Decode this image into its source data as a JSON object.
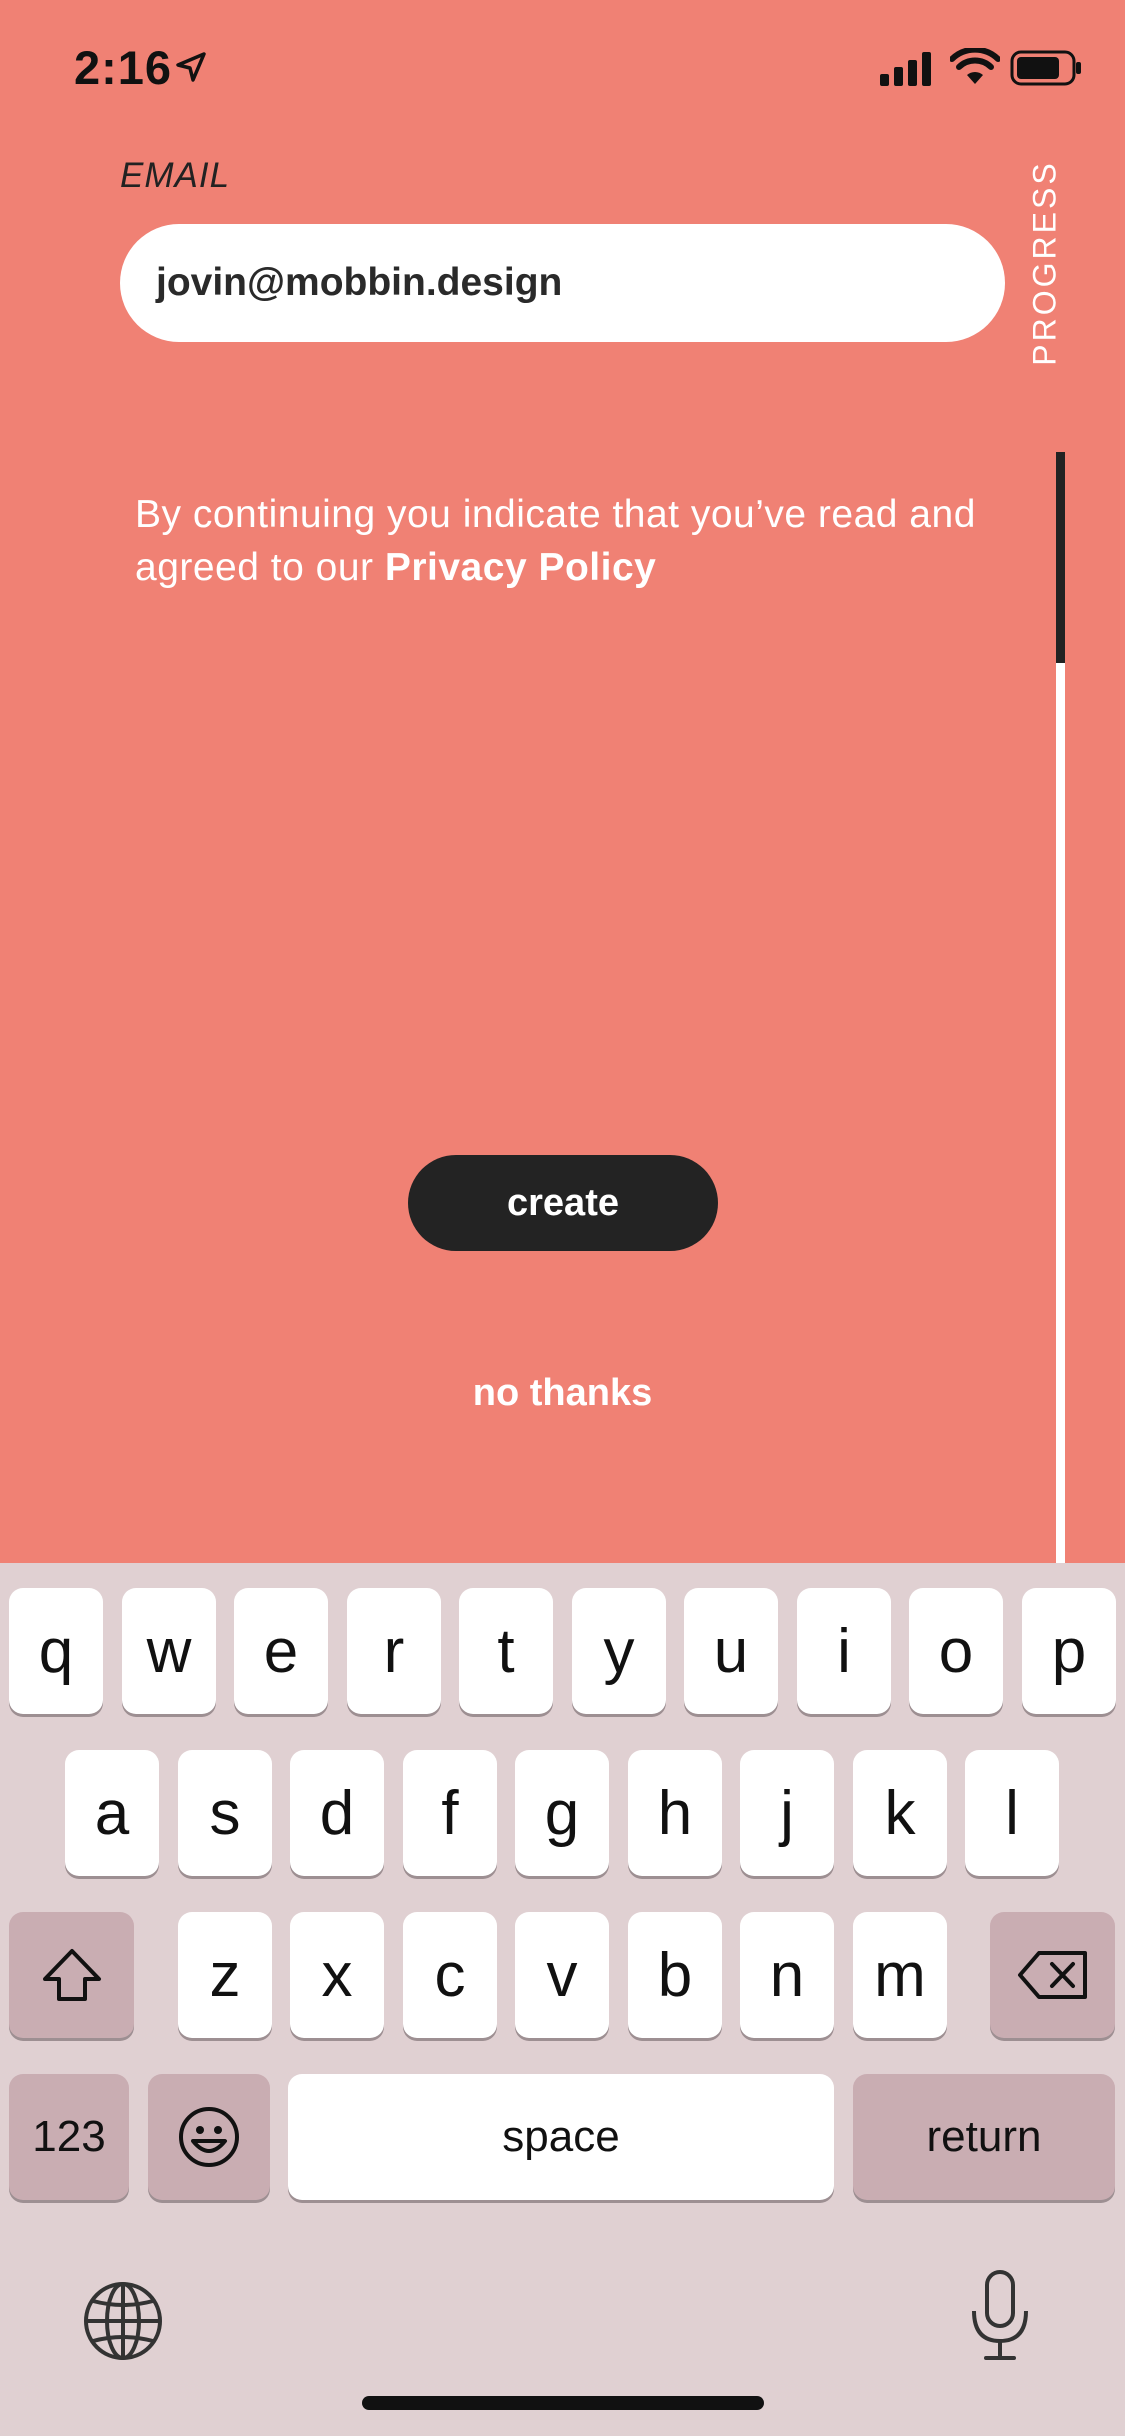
{
  "status": {
    "time": "2:16"
  },
  "form": {
    "email_label": "EMAIL",
    "email_value": "jovin@mobbin.design",
    "progress_label": "PROGRESS",
    "progress_fraction": 0.19,
    "policy_text": "By continuing you indicate that you’ve read and agreed to our ",
    "policy_link": "Privacy Policy",
    "create_label": "create",
    "no_thanks_label": "no thanks"
  },
  "colors": {
    "background": "#F08174",
    "button": "#232323",
    "keyboard": "#E0D0D2",
    "function_key": "#C9ADB2"
  },
  "keyboard": {
    "row1": [
      "q",
      "w",
      "e",
      "r",
      "t",
      "y",
      "u",
      "i",
      "o",
      "p"
    ],
    "row2": [
      "a",
      "s",
      "d",
      "f",
      "g",
      "h",
      "j",
      "k",
      "l"
    ],
    "row3": [
      "z",
      "x",
      "c",
      "v",
      "b",
      "n",
      "m"
    ],
    "numbers_key": "123",
    "space_key": "space",
    "return_key": "return",
    "icons": [
      "shift-icon",
      "delete-icon",
      "emoji-icon",
      "globe-icon",
      "microphone-icon"
    ]
  }
}
